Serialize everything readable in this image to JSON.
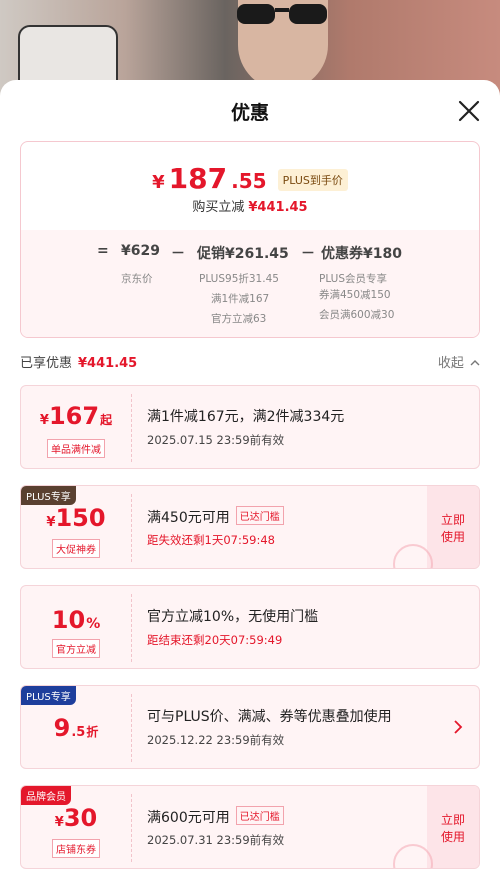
{
  "sheet": {
    "title": "优惠"
  },
  "summary": {
    "price_yen": "¥",
    "price_int": "187",
    "price_dec": ".55",
    "plus_badge": "PLUS到手价",
    "buy_label": "购买立减",
    "buy_amount": "¥441.45",
    "formula": {
      "eq": "=",
      "jd_price": "¥629",
      "minus1": "－",
      "promo": "促销¥261.45",
      "minus2": "－",
      "coupon": "优惠券¥180"
    },
    "jd_price_label": "京东价",
    "promo_lines": [
      "PLUS95折31.45",
      "满1件减167",
      "官方立减63"
    ],
    "coupon_lines": [
      "PLUS会员专享",
      "券满450减150",
      "会员满600减30"
    ]
  },
  "enjoyed": {
    "label": "已享优惠",
    "amount": "¥441.45",
    "collapse": "收起"
  },
  "coupons": [
    {
      "yen": "¥",
      "amount": "167",
      "unit": "起",
      "tag": "单品满件减",
      "title": "满1件减167元，满2件减334元",
      "sub": "2025.07.15  23:59前有效"
    },
    {
      "badge": "PLUS专享",
      "badge_color": "#5a4030",
      "yen": "¥",
      "amount": "150",
      "tag": "大促神券",
      "title": "满450元可用",
      "reached": "已达门槛",
      "sub": "距失效还剩1天07:59:48",
      "action_line1": "立即",
      "action_line2": "使用"
    },
    {
      "amount": "10",
      "unit": "%",
      "tag": "官方立减",
      "title": "官方立减10%，无使用门槛",
      "sub": "距结束还剩20天07:59:49"
    },
    {
      "badge": "PLUS专享",
      "badge_color": "#1e3e9c",
      "amount": "9",
      "amount_dec": ".5",
      "unit": "折",
      "title": "可与PLUS价、满减、券等优惠叠加使用",
      "sub": "2025.12.22  23:59前有效"
    },
    {
      "badge": "品牌会员",
      "badge_color": "#e4172b",
      "yen": "¥",
      "amount": "30",
      "tag": "店铺东券",
      "title": "满600元可用",
      "reached": "已达门槛",
      "sub": "2025.07.31  23:59前有效",
      "action_line1": "立即",
      "action_line2": "使用"
    }
  ],
  "colors": {
    "accent": "#e4172b",
    "card_bg": "#fff4f5"
  }
}
